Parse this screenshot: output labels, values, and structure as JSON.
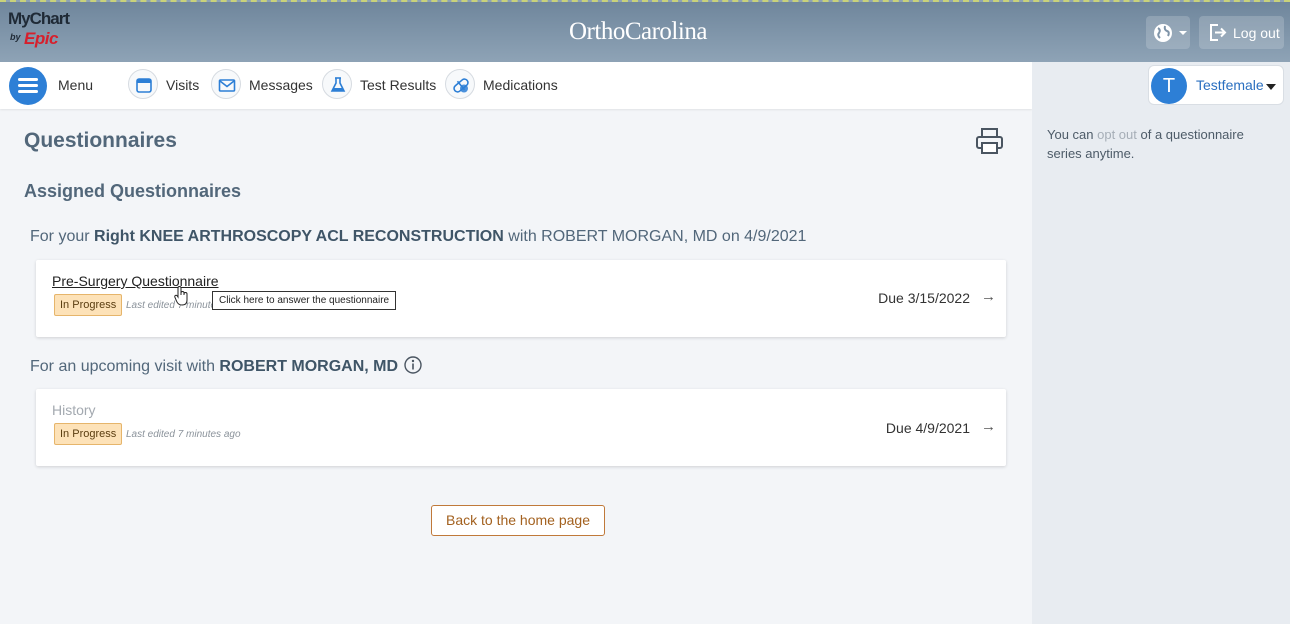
{
  "header": {
    "mychart_logo": "MyChart",
    "mychart_by": "by",
    "mychart_epic": "Epic",
    "brand": "OrthoCarolina",
    "logout_label": "Log out",
    "globe_icon": "globe-icon"
  },
  "nav": {
    "menu_label": "Menu",
    "items": [
      {
        "label": "Visits",
        "icon": "calendar-icon"
      },
      {
        "label": "Messages",
        "icon": "envelope-icon"
      },
      {
        "label": "Test Results",
        "icon": "flask-icon"
      },
      {
        "label": "Medications",
        "icon": "pill-icon"
      }
    ],
    "user_initial": "T",
    "user_name": "Testfemale"
  },
  "sidebar": {
    "text_before": "You can ",
    "link": "opt out",
    "text_after": " of a questionnaire series anytime."
  },
  "main": {
    "title": "Questionnaires",
    "section_title": "Assigned Questionnaires",
    "groups": [
      {
        "prefix": "For your ",
        "procedure": "Right KNEE ARTHROSCOPY ACL RECONSTRUCTION",
        "suffix": " with ROBERT MORGAN, MD on 4/9/2021",
        "questionnaire": {
          "name": "Pre-Surgery Questionnaire",
          "status": "In Progress",
          "edited": "Last edited 7 minutes ago",
          "due": "Due 3/15/2022"
        }
      },
      {
        "prefix": "For an upcoming visit with ",
        "procedure": "ROBERT MORGAN, MD",
        "suffix": "",
        "questionnaire": {
          "name": "History",
          "status": "In Progress",
          "edited": "Last edited 7 minutes ago",
          "due": "Due 4/9/2021"
        }
      }
    ],
    "tooltip": "Click here to answer the questionnaire",
    "home_button": "Back to the home page"
  },
  "colors": {
    "accent": "#2d7fd6",
    "badge_bg": "#fde2b8",
    "home_button": "#a3611f"
  }
}
